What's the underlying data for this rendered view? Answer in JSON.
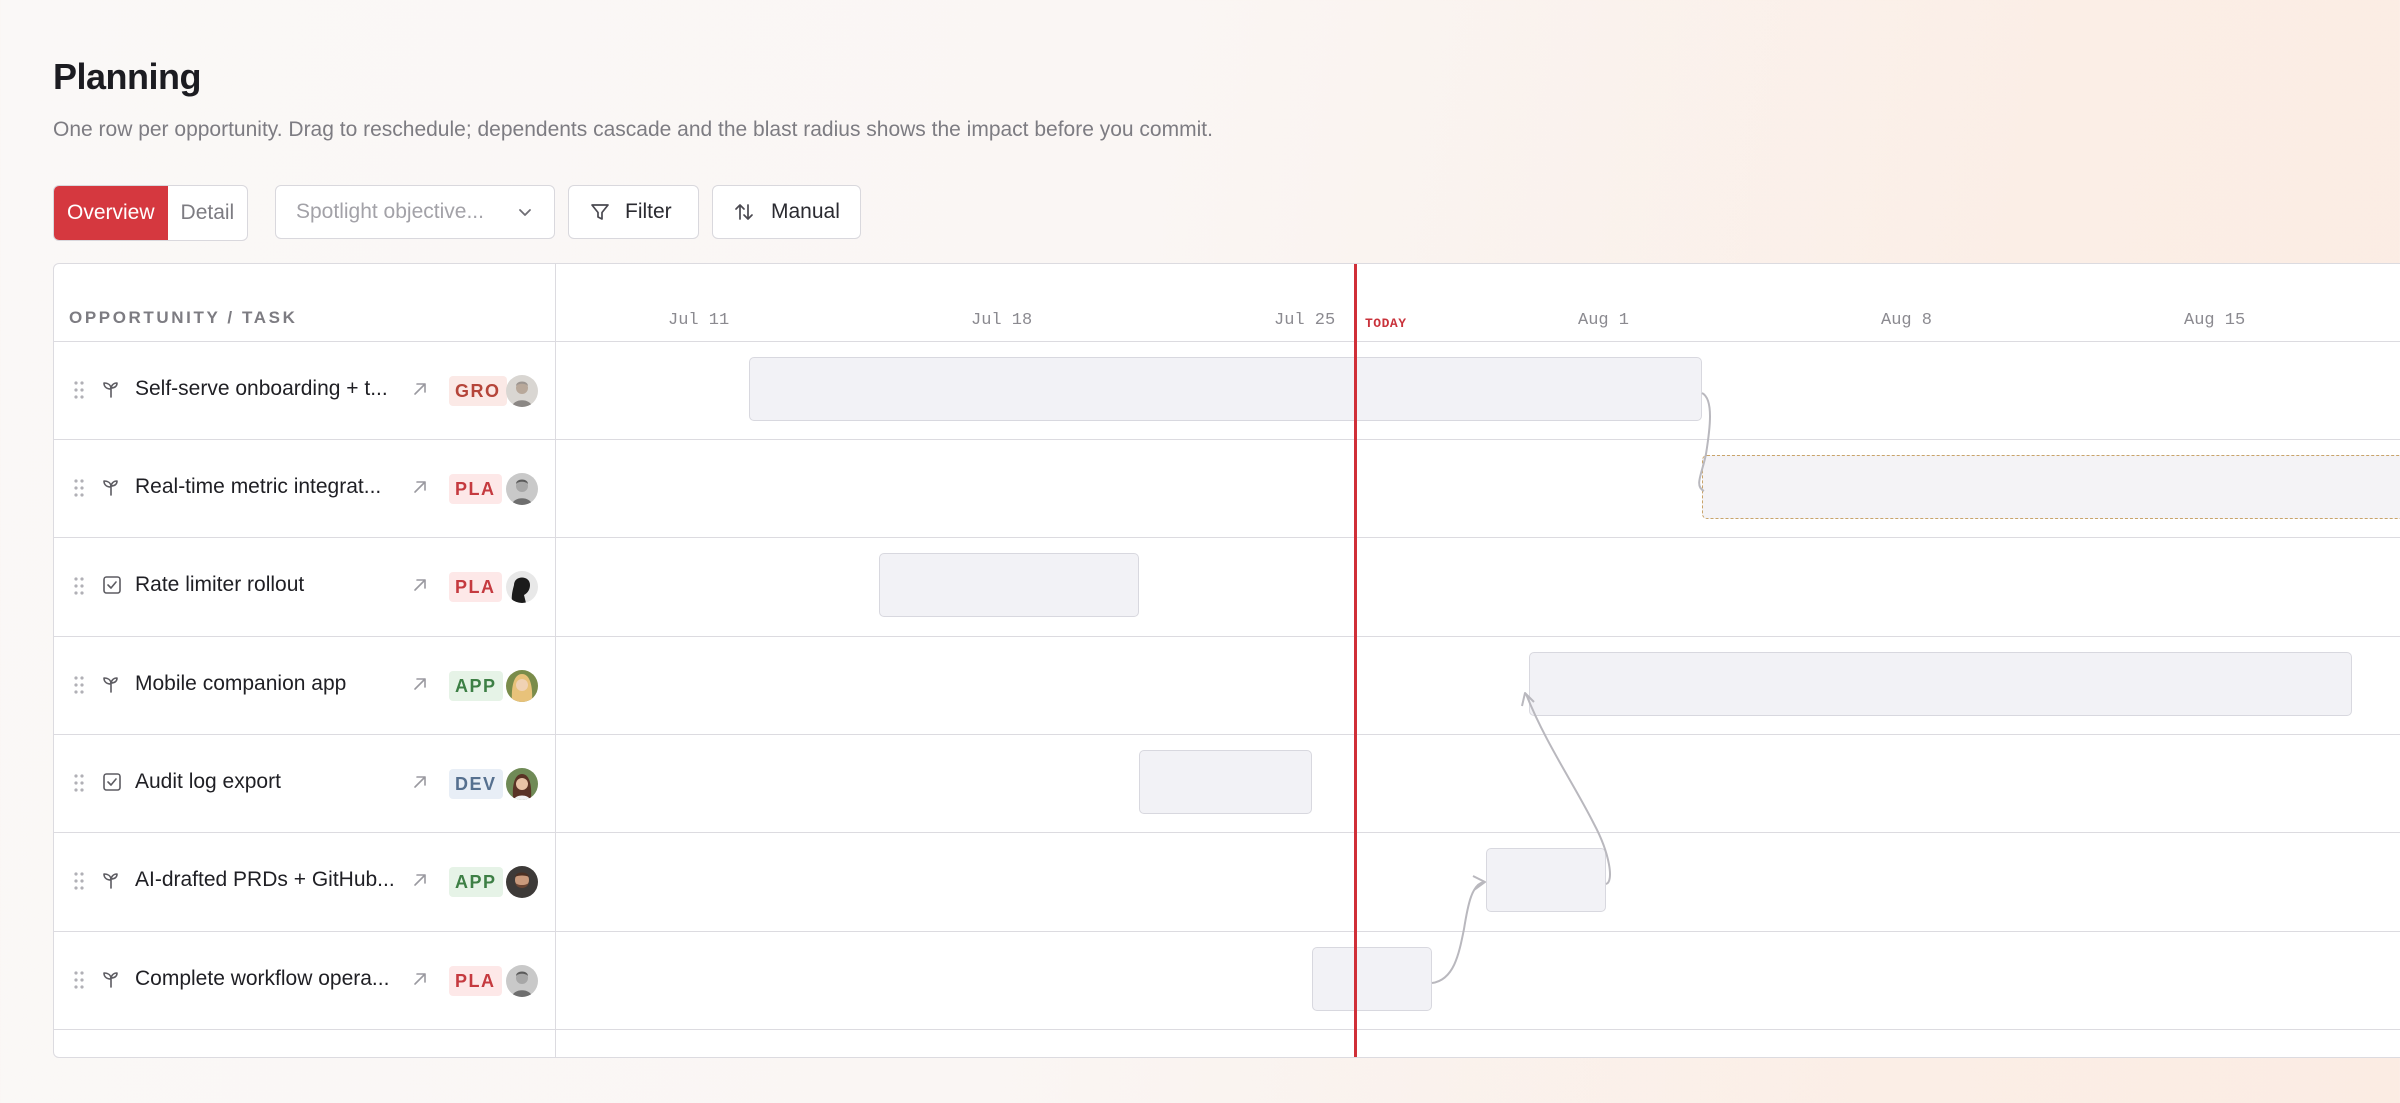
{
  "page": {
    "title": "Planning",
    "subtitle": "One row per opportunity. Drag to reschedule; dependents cascade and the blast radius shows the impact before you commit."
  },
  "toolbar": {
    "view_overview": "Overview",
    "view_detail": "Detail",
    "spotlight_placeholder": "Spotlight objective...",
    "filter_label": "Filter",
    "sort_label": "Manual"
  },
  "table": {
    "column_header": "OPPORTUNITY / TASK",
    "today_label": "TODAY",
    "timeline_ticks": [
      "Jul 11",
      "Jul 18",
      "Jul 25",
      "Aug 1",
      "Aug 8",
      "Aug 15"
    ],
    "rows": [
      {
        "name": "Self-serve onboarding + t...",
        "type_icon": "sprout-icon",
        "badge": "GRO",
        "badge_color": "#b5453a",
        "badge_bg": "#fbe9e6",
        "avatar": "avatar-gray"
      },
      {
        "name": "Real-time metric integrat...",
        "type_icon": "sprout-icon",
        "badge": "PLA",
        "badge_color": "#c53a3f",
        "badge_bg": "#fde8e8",
        "avatar": "avatar-bw"
      },
      {
        "name": "Rate limiter rollout",
        "type_icon": "checkbox-icon",
        "badge": "PLA",
        "badge_color": "#c53a3f",
        "badge_bg": "#fde8e8",
        "avatar": "avatar-dark"
      },
      {
        "name": "Mobile companion app",
        "type_icon": "sprout-icon",
        "badge": "APP",
        "badge_color": "#3d7f45",
        "badge_bg": "#e6f3e7",
        "avatar": "avatar-blonde"
      },
      {
        "name": "Audit log export",
        "type_icon": "checkbox-icon",
        "badge": "DEV",
        "badge_color": "#56708f",
        "badge_bg": "#e8eef6",
        "avatar": "avatar-brunette"
      },
      {
        "name": "AI-drafted PRDs + GitHub...",
        "type_icon": "sprout-icon",
        "badge": "APP",
        "badge_color": "#3d7f45",
        "badge_bg": "#e6f3e7",
        "avatar": "avatar-beard"
      },
      {
        "name": "Complete workflow opera...",
        "type_icon": "sprout-icon",
        "badge": "PLA",
        "badge_color": "#c53a3f",
        "badge_bg": "#fde8e8",
        "avatar": "avatar-bw"
      }
    ]
  },
  "colors": {
    "accent": "#d5383f",
    "today_line": "#d02f38",
    "bar_fill": "#f2f2f6",
    "dependency_line": "#b9b8be"
  }
}
